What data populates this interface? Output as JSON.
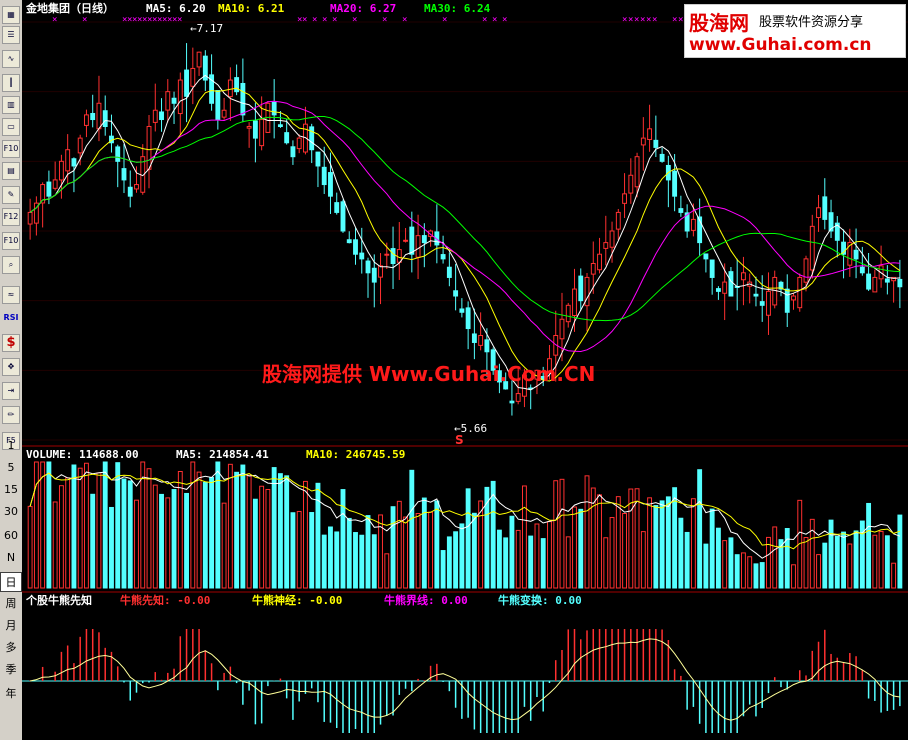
{
  "toolbar": {
    "buttons": [
      "grid-icon",
      "list-icon",
      "line-chart-icon",
      "candle-icon",
      "bars-icon",
      "window-icon",
      "f10-icon",
      "doc-icon",
      "notes-icon",
      "f12-icon",
      "f10-alt-icon",
      "search-icon",
      "wave-icon",
      "rsi-icon",
      "dollar-icon",
      "move-icon",
      "export-icon",
      "pen-icon",
      "f5-icon"
    ],
    "rsi_label": "RSI",
    "periods": [
      "1",
      "5",
      "15",
      "30",
      "60",
      "N",
      "日",
      "周",
      "月",
      "多",
      "季",
      "年"
    ],
    "active_period": "日"
  },
  "header": {
    "stock": "金地集团（日线）",
    "ma5": "MA5: 6.20",
    "ma10": "MA10: 6.21",
    "ma20": "MA20: 6.27",
    "ma30": "MA30: 6.24"
  },
  "price_annotations": {
    "high": "7.17",
    "low": "5.66",
    "low_marker": "S"
  },
  "volume_header": {
    "volume": "VOLUME: 114688.00",
    "ma5": "MA5: 214854.41",
    "ma10": "MA10: 246745.59"
  },
  "indicator_header": {
    "name": "个股牛熊先知",
    "xianzhi": "牛熊先知: -0.00",
    "shenjing": "牛熊神经: -0.00",
    "jiexian": "牛熊界线: 0.00",
    "biandong": "牛熊变换: 0.00"
  },
  "logo": {
    "brand": "股海网",
    "tagline": "股票软件资源分享",
    "url": "www.Guhai.com.cn"
  },
  "watermark": "股海网提供 Www.Guhai.Com.CN",
  "colors": {
    "up": "#ff3030",
    "down": "#54ffff",
    "ma5": "#ffffff",
    "ma10": "#ffff00",
    "ma20": "#ff00ff",
    "ma30": "#00ff00",
    "axis": "#a00000"
  },
  "chart_data": [
    {
      "type": "candlestick",
      "title": "金地集团（日线）",
      "ylim": [
        5.5,
        7.3
      ],
      "series": [
        {
          "name": "MA5",
          "value": 6.2
        },
        {
          "name": "MA10",
          "value": 6.21
        },
        {
          "name": "MA20",
          "value": 6.27
        },
        {
          "name": "MA30",
          "value": 6.24
        }
      ],
      "annotations": [
        {
          "label": "7.17",
          "value": 7.17
        },
        {
          "label": "5.66",
          "value": 5.66
        }
      ],
      "close": [
        6.48,
        6.52,
        6.6,
        6.55,
        6.62,
        6.7,
        6.75,
        6.68,
        6.8,
        6.9,
        6.88,
        6.95,
        6.85,
        6.78,
        6.7,
        6.62,
        6.55,
        6.6,
        6.72,
        6.85,
        6.92,
        6.88,
        7.0,
        6.95,
        7.05,
        6.98,
        7.1,
        7.17,
        7.05,
        6.95,
        6.88,
        6.92,
        7.05,
        7.0,
        6.9,
        6.85,
        6.8,
        6.88,
        6.95,
        6.9,
        6.85,
        6.78,
        6.72,
        6.8,
        6.86,
        6.75,
        6.68,
        6.6,
        6.55,
        6.48,
        6.4,
        6.35,
        6.3,
        6.28,
        6.22,
        6.18,
        6.25,
        6.3,
        6.26,
        6.32,
        6.36,
        6.3,
        6.38,
        6.35,
        6.4,
        6.34,
        6.28,
        6.2,
        6.12,
        6.05,
        5.98,
        5.92,
        5.95,
        5.88,
        5.8,
        5.75,
        5.72,
        5.66,
        5.7,
        5.78,
        5.72,
        5.8,
        5.76,
        5.85,
        5.95,
        6.02,
        6.08,
        6.15,
        6.1,
        6.2,
        6.26,
        6.3,
        6.35,
        6.4,
        6.48,
        6.56,
        6.64,
        6.72,
        6.8,
        6.84,
        6.76,
        6.7,
        6.62,
        6.55,
        6.48,
        6.4,
        6.45,
        6.35,
        6.28,
        6.2,
        6.14,
        6.18,
        6.12,
        6.16,
        6.22,
        6.18,
        6.12,
        6.08,
        6.14,
        6.2,
        6.15,
        6.05,
        6.12,
        6.2,
        6.28,
        6.42,
        6.5,
        6.45,
        6.4,
        6.36,
        6.3,
        6.35,
        6.28,
        6.22,
        6.15,
        6.2,
        6.25,
        6.18,
        6.2,
        6.16
      ]
    },
    {
      "type": "bar",
      "title": "VOLUME",
      "series": [
        {
          "name": "VOLUME",
          "value": 114688.0
        },
        {
          "name": "MA5",
          "value": 214854.41
        },
        {
          "name": "MA10",
          "value": 246745.59
        }
      ]
    },
    {
      "type": "bar",
      "title": "个股牛熊先知",
      "series": [
        {
          "name": "牛熊先知",
          "value": -0.0
        },
        {
          "name": "牛熊神经",
          "value": -0.0
        },
        {
          "name": "牛熊界线",
          "value": 0.0
        },
        {
          "name": "牛熊变换",
          "value": 0.0
        }
      ]
    }
  ]
}
